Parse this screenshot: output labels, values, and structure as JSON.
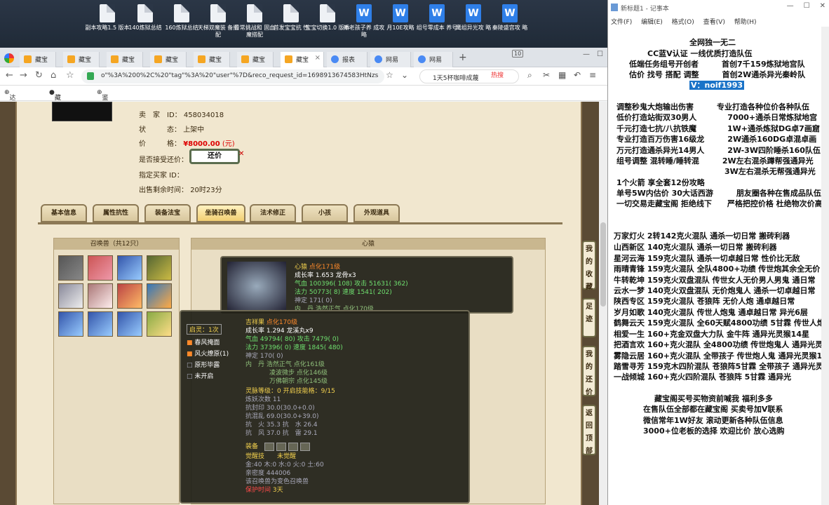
{
  "desktop": {
    "icons": [
      {
        "label": "副本攻略1.5 版本",
        "type": "doc"
      },
      {
        "label": "140炼狱总结",
        "type": "doc"
      },
      {
        "label": "160炼狱总结",
        "type": "doc"
      },
      {
        "label": "天梯双魔装 备搭配",
        "type": "doc"
      },
      {
        "label": "日常挑战和 固血魔搭配",
        "type": "doc"
      },
      {
        "label": "首发宝宝抗 性",
        "type": "doc"
      },
      {
        "label": "宝宝切换1.0 版本",
        "type": "doc"
      },
      {
        "label": "新老孩子养 成攻略",
        "type": "word"
      },
      {
        "label": "月10E攻略",
        "type": "word"
      },
      {
        "label": "组号零成本 养号",
        "type": "word"
      },
      {
        "label": "鹰组异光攻 略",
        "type": "word"
      },
      {
        "label": "秦陵盛宫攻 略",
        "type": "word"
      }
    ]
  },
  "browser": {
    "tabs": [
      {
        "label": "藏宝"
      },
      {
        "label": "藏宝"
      },
      {
        "label": "藏宝"
      },
      {
        "label": "藏宝"
      },
      {
        "label": "藏宝"
      },
      {
        "label": "藏宝"
      },
      {
        "label": "藏宝"
      },
      {
        "label": "报表"
      },
      {
        "label": "网易"
      },
      {
        "label": "网易"
      }
    ],
    "tab_count": "10",
    "url": "o\"%3A%200%2C%20\"tag\"%3A%20\"user\"%7D&reco_request_id=1698913674583HtNzs",
    "search": "1天5杯咖啡成蔑",
    "search_hot": "热搜",
    "bookmarks": [
      "达人后台",
      "藏宝阁_",
      "鉴宝广场"
    ]
  },
  "listing": {
    "seller_label": "卖　家　ID：",
    "seller_id": "458034018",
    "status_label": "状　　　态：",
    "status": "上架中",
    "price_label": "价　　　格：",
    "price": "¥8000.00",
    "price_unit": "(元)",
    "bargain_label": "是否接受还价：",
    "bargain_button": "还价",
    "buyer_label": "指定买家 ID：",
    "remaining_label": "出售剩余时间：",
    "remaining": "20时23分"
  },
  "page_tabs": [
    "基本信息",
    "属性抗性",
    "装备法宝",
    "坐骑召唤兽",
    "法术修正",
    "小孩",
    "外观道具"
  ],
  "summons_panel": {
    "title": "召唤兽（共12只）"
  },
  "detail_panel": {
    "title": "心猿"
  },
  "pet_tip_1": {
    "name": "心猿",
    "tag": "点化171级",
    "growth": "成长率 1.653 龙骨x3",
    "hp": "气血 100396( 108) 攻击 51631( 362)",
    "mp": "法力 50773( 8) 速度 1541( 202)",
    "spirit": "神定 171( 0)",
    "inner": "内　丹 浩然正气 点化170级"
  },
  "pet_tip_2": {
    "badge": "启灵：1次",
    "skills": [
      "春风掩面",
      "风火燎原(1)",
      "原形毕露",
      "未开启"
    ],
    "name": "吉祥果",
    "tag": "点化170级",
    "growth": "成长率 1.294 龙溪丸x9",
    "hp": "气血 49794( 80) 攻击 7479( 0)",
    "mp": "法力 37396( 0) 速度 1845( 480)",
    "spirit": "神定 170( 0)",
    "inner1": "内　丹 浩然正气 点化161级",
    "inner2": "凌波微步 点化146级",
    "inner3": "万佛朝宗 点化145级",
    "level": "灵脉等级：0 开启技能格：9/15",
    "refine": "炼妖次数 11",
    "resist1": "抗封印 30.0(30.0+0.0)",
    "resist2": "抗混乱 69.0(30.0+39.0)",
    "resist3": "抗　火 35.3 抗　水 26.4",
    "resist4": "抗　风 37.0 抗　雷 29.1",
    "equip": "装备",
    "awaken": "觉醒技　　未觉醒",
    "elements": "金:40 木:0 水:0 火:0 土:60",
    "intimacy": "亲密度 444006",
    "note": "该召唤兽为变色召唤兽",
    "protect": "保护时间",
    "protect_val": "3天"
  },
  "side_buttons": [
    "我的收藏",
    "足迹",
    "我的还价",
    "返回顶部"
  ],
  "notepad": {
    "title": "新标题1 - 记事本",
    "menu": [
      "文件(F)",
      "编辑(E)",
      "格式(O)",
      "查看(V)",
      "帮助(H)"
    ],
    "lines": [
      "全网独一无二",
      "CC蓝V认证 一线优质打造队伍",
      "低端任务组号开创者　　　首创7千159炼狱地宫队",
      "估价 找号 搭配 调整　　　首创2W通杀异光秦岭队",
      "V：noif1993",
      "调整秒鬼大炮输出伤害　　　专业打造各种位价各种队伍",
      "低价打造站街双30男人　　　　7000+通杀日常炼狱地宫",
      "千元打造七抗/八抗铁魔　　　　1W+通杀炼狱DG卓7画窟",
      "专业打造百万伤害16级龙　　　2W通杀160DG卓混卓画",
      "万元打造通杀异光14男人　　　2W-3W四阶睡杀160队伍",
      "组号调整 混转睡/睡转混　　　2W左右混杀蹲帮强通异光",
      "　　　　　　　　　　　　　　3W左右混杀无帮强通异光",
      "1个火箭 享全套12份攻略",
      "单号5W内估价 30大话西游　　　朋友圈各种在售成品队伍",
      "一切交易走藏宝阁 拒绝线下　　严格把控价格 杜绝物次价高",
      "万家灯火 2转142克火混队 通杀一切日常 搬砖利器",
      "山西新区 140克火混队 通杀一切日常 搬砖利器",
      "星河云海 159克火混队 通杀一切卓越日常 性价比无敌",
      "雨晴青锋 159克火混队 全队4800+功绩 传世炮其余全无价",
      "牛转乾坤 159克火双盘混队 传世女人无价男人男鬼 通日常",
      "云水一梦 140克火双盘混队 无价炮鬼人 通杀一切卓越日常",
      "陕西专区 159克火混队 苍狼阵 无价人炮 通卓越日常",
      "岁月如歌 140克火混队 传世人炮鬼 通卓越日常 异光6层",
      "鹤舞云天 159克火混队 全60天赋4800功绩 5甘霖 传世人炮",
      "相爱一生 160+克金双盘大力队 金牛阵 通异光灵猴14星",
      "把酒言欢 160+克火混队 全4800功绩 传世炮鬼人 通异光灵猴",
      "雾隐云居 160+克火混队 全带孩子 传世炮人鬼 通异光灵猴14",
      "踏雪寻芳 159克木四阶混队 苍狼阵5甘霖 全带孩子 通异光灵猴",
      "一战倾城 160+克火四阶混队 苍狼阵 5甘霖 通异光",
      "藏宝阁买号买物资前喊我 福利多多",
      "在售队伍全部都在藏宝阁 买卖号加V联系",
      "微信常年1W好友 滚动更新各种队伍信息",
      "3000+位老板的选择 欢迎比价 放心选购"
    ]
  }
}
